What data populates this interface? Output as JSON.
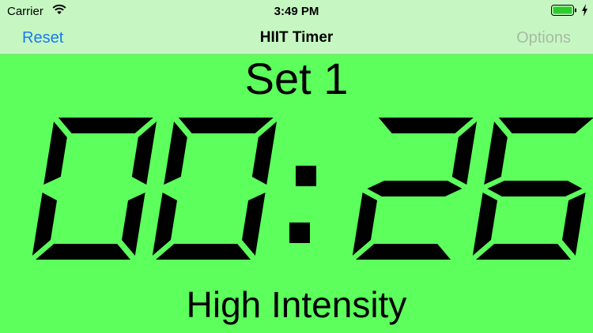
{
  "status_bar": {
    "carrier": "Carrier",
    "time": "3:49 PM",
    "wifi_icon": "wifi-icon",
    "battery_icon": "battery-full-icon",
    "charging_icon": "lightning-bolt-icon"
  },
  "nav": {
    "reset_label": "Reset",
    "title": "HIIT Timer",
    "options_label": "Options"
  },
  "timer": {
    "set_label": "Set 1",
    "time": "00:26",
    "phase": "High Intensity"
  },
  "colors": {
    "background": "#5cff5c",
    "topbar": "#c6f7c2",
    "accent": "#1a78f2",
    "disabled": "#aab8a8",
    "battery": "#2ecc2e"
  }
}
